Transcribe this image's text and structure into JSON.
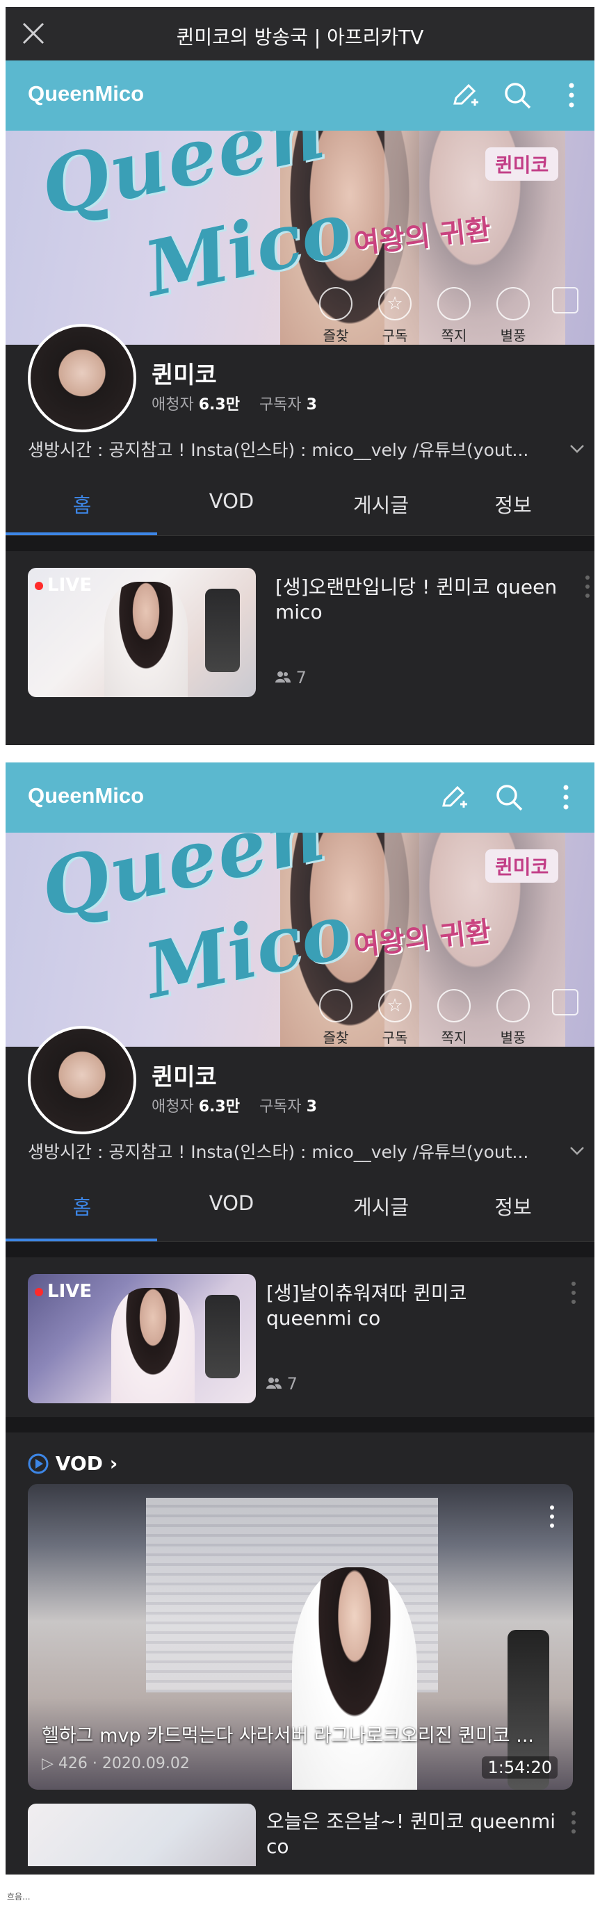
{
  "window": {
    "title": "퀸미코의 방송국 | 아프리카TV"
  },
  "channel": {
    "brand": "QueenMico",
    "banner_script_1": "Queen",
    "banner_script_2": "Mico",
    "banner_badge": "퀸미코",
    "banner_subtitle": "여왕의 귀환",
    "actions": [
      "즐찾",
      "구독",
      "쪽지",
      "별풍"
    ],
    "name": "퀸미코",
    "fans_label": "애청자",
    "fans_value": "6.3만",
    "subs_label": "구독자",
    "subs_value": "3",
    "description": "생방시간 : 공지참고 ! Insta(인스타) : mico__vely /유튜브(yout..."
  },
  "tabs": [
    "홈",
    "VOD",
    "게시글",
    "정보"
  ],
  "active_tab": "홈",
  "screen1": {
    "live": {
      "badge": "LIVE",
      "title": "[생]오랜만입니당 ! 퀸미코 queen mico",
      "viewers": "7"
    }
  },
  "screen2": {
    "live": {
      "badge": "LIVE",
      "title": "[생]날이츄워져따 퀸미코 queenmi co",
      "viewers": "7"
    },
    "vod_section": "VOD",
    "vod": {
      "title": "헬하그 mvp 카드먹는다 사라서버 라그나로크오리진 퀸미코 ...",
      "views": "426",
      "date": "2020.09.02",
      "duration": "1:54:20"
    },
    "vod2_title": "오늘은 조은날~! 퀸미코 queenmi co"
  },
  "caption": "흐음...",
  "colors": {
    "accent": "#3d86e6",
    "appbar": "#5bb8cf",
    "background": "#252527",
    "live_dot": "#ff2a2a"
  },
  "icons": [
    "close-icon",
    "edit-icon",
    "search-icon",
    "more-icon",
    "chevron-down-icon",
    "viewers-icon",
    "play-circle-icon"
  ]
}
